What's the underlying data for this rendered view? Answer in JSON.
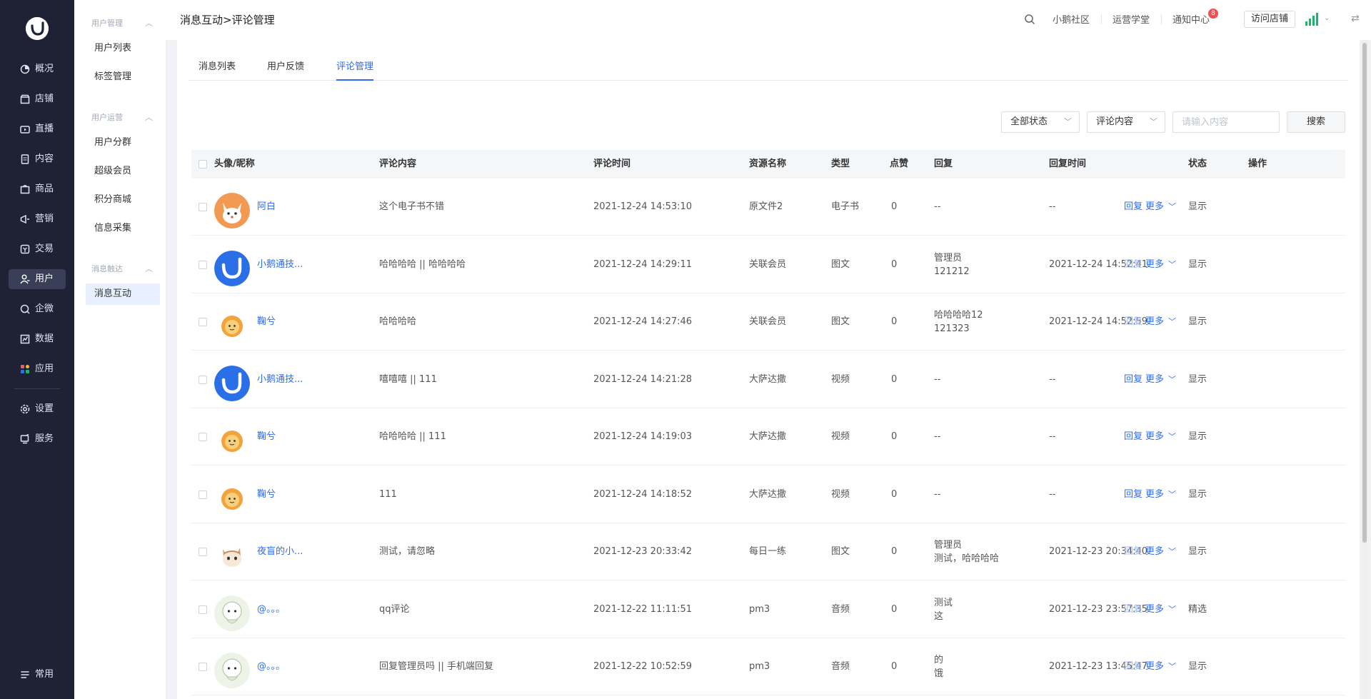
{
  "nav": {
    "items": [
      {
        "label": "概况",
        "icon": "overview-icon"
      },
      {
        "label": "店铺",
        "icon": "store-icon"
      },
      {
        "label": "直播",
        "icon": "live-icon"
      },
      {
        "label": "内容",
        "icon": "content-icon"
      },
      {
        "label": "商品",
        "icon": "product-icon"
      },
      {
        "label": "营销",
        "icon": "marketing-icon"
      },
      {
        "label": "交易",
        "icon": "transaction-icon"
      },
      {
        "label": "用户",
        "icon": "user-icon"
      },
      {
        "label": "企微",
        "icon": "wecom-icon"
      },
      {
        "label": "数据",
        "icon": "data-icon"
      },
      {
        "label": "应用",
        "icon": "apps-icon"
      },
      {
        "label": "设置",
        "icon": "settings-icon"
      },
      {
        "label": "服务",
        "icon": "service-icon"
      },
      {
        "label": "常用",
        "icon": "favorites-icon"
      }
    ],
    "active": "用户"
  },
  "submenu": {
    "groups": [
      {
        "title": "用户管理",
        "items": [
          "用户列表",
          "标签管理"
        ]
      },
      {
        "title": "用户运营",
        "items": [
          "用户分群",
          "超级会员",
          "积分商城",
          "信息采集"
        ]
      },
      {
        "title": "消息触达",
        "items": [
          "消息互动"
        ]
      }
    ],
    "active": "消息互动"
  },
  "topbar": {
    "breadcrumb": "消息互动>评论管理",
    "links": [
      "小鹅社区",
      "运营学堂",
      "通知中心"
    ],
    "badge_count": "8",
    "visit_store": "访问店铺"
  },
  "tabs": [
    "消息列表",
    "用户反馈",
    "评论管理"
  ],
  "active_tab": "评论管理",
  "filters": {
    "status_select": "全部状态",
    "field_select": "评论内容",
    "search_placeholder": "请输入内容",
    "search_button": "搜索"
  },
  "table": {
    "columns": [
      "头像/昵称",
      "评论内容",
      "评论时间",
      "资源名称",
      "类型",
      "点赞",
      "回复",
      "回复时间",
      "状态",
      "操作"
    ],
    "rows": [
      {
        "avatar": "fox-avatar",
        "nickname": "阿白",
        "content": "这个电子书不错",
        "time": "2021-12-24 14:53:10",
        "resource": "原文件2",
        "type": "电子书",
        "likes": "0",
        "reply": [
          "--"
        ],
        "reply_time": "--",
        "status": "显示",
        "reply_enabled": true
      },
      {
        "avatar": "brand-avatar",
        "nickname": "小鹅通技...",
        "content": "哈哈哈哈 || 哈哈哈哈",
        "time": "2021-12-24 14:29:11",
        "resource": "关联会员",
        "type": "图文",
        "likes": "0",
        "reply": [
          "管理员",
          "121212"
        ],
        "reply_time": "2021-12-24 14:52:41",
        "status": "显示",
        "reply_enabled": false
      },
      {
        "avatar": "lion-avatar",
        "nickname": "鞠兮",
        "content": "哈哈哈哈",
        "time": "2021-12-24 14:27:46",
        "resource": "关联会员",
        "type": "图文",
        "likes": "0",
        "reply": [
          "哈哈哈哈12",
          "121323"
        ],
        "reply_time": "2021-12-24 14:52:59",
        "status": "显示",
        "reply_enabled": false
      },
      {
        "avatar": "brand-avatar",
        "nickname": "小鹅通技...",
        "content": "嘻嘻嘻 || 111",
        "time": "2021-12-24 14:21:28",
        "resource": "大萨达撒",
        "type": "视频",
        "likes": "0",
        "reply": [
          "--"
        ],
        "reply_time": "--",
        "status": "显示",
        "reply_enabled": true
      },
      {
        "avatar": "lion-avatar",
        "nickname": "鞠兮",
        "content": "哈哈哈哈 || 111",
        "time": "2021-12-24 14:19:03",
        "resource": "大萨达撒",
        "type": "视频",
        "likes": "0",
        "reply": [
          "--"
        ],
        "reply_time": "--",
        "status": "显示",
        "reply_enabled": true
      },
      {
        "avatar": "lion-avatar",
        "nickname": "鞠兮",
        "content": "111",
        "time": "2021-12-24 14:18:52",
        "resource": "大萨达撒",
        "type": "视频",
        "likes": "0",
        "reply": [
          "--"
        ],
        "reply_time": "--",
        "status": "显示",
        "reply_enabled": true
      },
      {
        "avatar": "cat-avatar",
        "nickname": "夜盲的小...",
        "content": "测试，请忽略",
        "time": "2021-12-23 20:33:42",
        "resource": "每日一练",
        "type": "图文",
        "likes": "0",
        "reply": [
          "管理员",
          "测试，哈哈哈哈"
        ],
        "reply_time": "2021-12-23 20:34:40",
        "status": "显示",
        "reply_enabled": false
      },
      {
        "avatar": "doll-avatar",
        "nickname": "@。。。",
        "content": "qq评论",
        "time": "2021-12-22 11:11:51",
        "resource": "pm3",
        "type": "音频",
        "likes": "0",
        "reply": [
          "测试",
          "这"
        ],
        "reply_time": "2021-12-23 23:57:35",
        "status": "精选",
        "reply_enabled": false
      },
      {
        "avatar": "doll-avatar",
        "nickname": "@。。。",
        "content": "回复管理员吗 || 手机端回复",
        "time": "2021-12-22 10:52:59",
        "resource": "pm3",
        "type": "音频",
        "likes": "0",
        "reply": [
          "的",
          "饿"
        ],
        "reply_time": "2021-12-23 13:45:47",
        "status": "显示",
        "reply_enabled": false
      }
    ],
    "op_reply": "回复",
    "op_more": "更多"
  },
  "colors": {
    "nav_bg": "#1f2235",
    "accent": "#2e6cf0",
    "accent_disabled": "#9dbbf5",
    "brand_blue": "#2b6fe8",
    "signal_green": "#1fb46b"
  }
}
